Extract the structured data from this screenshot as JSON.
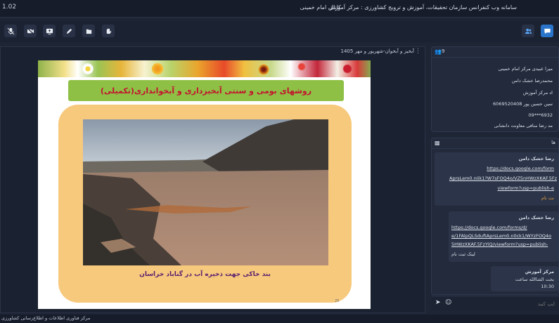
{
  "app": {
    "version": "1.02",
    "title": "سامانه وب کنفرانس سازمان تحقیقات، آموزش و ترویج کشاورزی : مرکز آموزش امام خمینی",
    "exit_label": "کانال"
  },
  "toolbar": {
    "icons": [
      "mic-icon",
      "camera-off-icon",
      "screen-share-icon",
      "pen-icon",
      "document-icon",
      "hand-icon",
      "users-icon",
      "chat-icon"
    ],
    "accent": "#2a74c9"
  },
  "stage": {
    "caption": "آبخیز و آبخوان-شهریور و مهر 1405",
    "slide": {
      "title": "روشهای بومی و سنتی آبخیزداری و آبخوانداری(تکمیلی)",
      "caption": "بند خاکی جهت ذخیره آب در گناباد خراسان",
      "page_number": "25",
      "title_color": "#c3122d",
      "banner_color": "#8fc046",
      "frame_color": "#f7c97d"
    }
  },
  "users": {
    "count": "9",
    "items": [
      "میرا عبیدی مرکز امام خمینی",
      "محمدرضا خشک دامن",
      "اد مرکز آموزش",
      "سین حسین پور 6069520408",
      "6932***09",
      "مد رضا منافی معاونت دانشانی"
    ]
  },
  "chat": {
    "title": "ها",
    "messages": [
      {
        "author": "رضا خشک دامن",
        "lines": [
          "https://docs.google.com/form",
          "AprsLem0.nIik1?W7sFOQ4o/VZ5nHWzXKAF.5Fz",
          "viewform?usp=publish-e",
          "نت نام"
        ]
      },
      {
        "author": "رضا خشک دامن",
        "lines": [
          "https://docs.google.com/forms/d/",
          "e/1FAlpQLSduftAprsLem0.n0ck1/WYzFOQ4o",
          "5HWzXKAF.5FzYiQ/viewform?usp=publish-",
          "لینک ثبت نام"
        ]
      },
      {
        "author": "مرکز آموزش",
        "lines": [
          "بخت الشاالله ساعت",
          "10:30"
        ]
      }
    ],
    "input_placeholder": "ایپ کنید"
  },
  "status": {
    "text": "مرکز فناوری اطلاعات و اطلاع‌رسانی کشاورزی"
  }
}
